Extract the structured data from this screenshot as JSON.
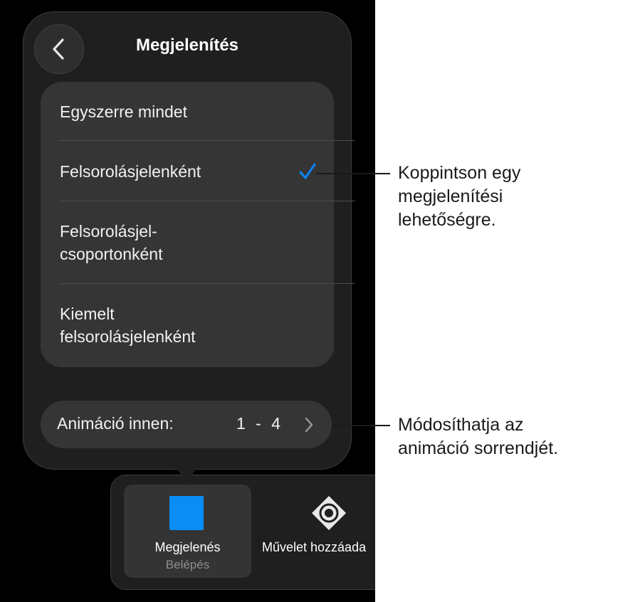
{
  "popover": {
    "title": "Megjelenítés",
    "back_icon": "chevron-left-icon",
    "options": [
      {
        "label": "Egyszerre mindet",
        "selected": false
      },
      {
        "label": "Felsorolásjelenként",
        "selected": true
      },
      {
        "label": "Felsorolásjel-\ncsoportonként",
        "selected": false
      },
      {
        "label": "Kiemelt\nfelsorolásjelenként",
        "selected": false
      }
    ],
    "check_icon": "checkmark-icon",
    "animate_from": {
      "label": "Animáció innen:",
      "range": "1 - 4",
      "icon": "chevron-right-icon"
    }
  },
  "toolbar": {
    "selected_tool": {
      "name": "Megjelenés",
      "subtitle": "Belépés"
    },
    "add_action": {
      "label": "Művelet hozzáada",
      "icon": "add-action-icon"
    }
  },
  "callouts": {
    "options_note": "Koppintson egy\nmegjelenítési\nlehetőségre.",
    "animation_note": "Módosíthatja az\nanimáció sorrendjét."
  },
  "colors": {
    "accent": "#0a84ff",
    "tool_color": "#0a8ef5",
    "panel": "#1f1f1f",
    "row": "#353535"
  }
}
